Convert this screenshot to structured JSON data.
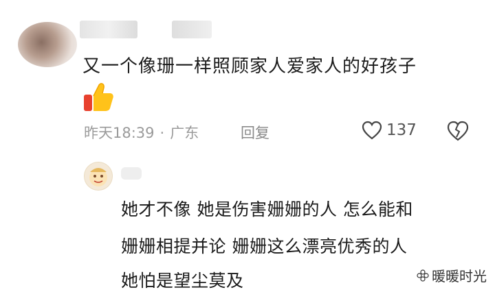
{
  "comment": {
    "text": "又一个像珊一样照顾家人爱家人的好孩子",
    "emoji": "thumbs-up-emoji",
    "time": "昨天18:39",
    "separator": "·",
    "location": "广东",
    "reply_label": "回复",
    "like_count": "137"
  },
  "reply": {
    "line1": "她才不像  她是伤害姗姗的人 怎么能和",
    "line2": "姗姗相提并论  姗姗这么漂亮优秀的人",
    "line3": "她怕是望尘莫及"
  },
  "watermark": {
    "text": "暖暖时光"
  },
  "colors": {
    "meta": "#9a9a9a",
    "text": "#1a1a1a"
  }
}
